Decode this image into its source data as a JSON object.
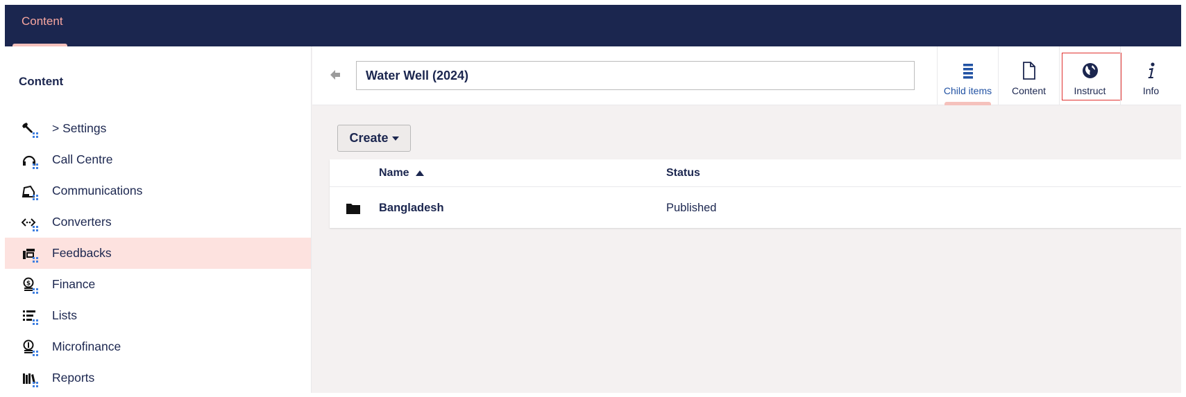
{
  "topbar": {
    "section_label": "Content"
  },
  "sidebar": {
    "title": "Content",
    "items": [
      {
        "label": "> Settings",
        "icon": "wrench-icon"
      },
      {
        "label": "Call Centre",
        "icon": "headset-icon"
      },
      {
        "label": "Communications",
        "icon": "inbox-icon"
      },
      {
        "label": "Converters",
        "icon": "code-arrows-icon"
      },
      {
        "label": "Feedbacks",
        "icon": "feedback-icon",
        "active": true
      },
      {
        "label": "Finance",
        "icon": "coins-icon"
      },
      {
        "label": "Lists",
        "icon": "list-icon"
      },
      {
        "label": "Microfinance",
        "icon": "microfinance-coins-icon"
      },
      {
        "label": "Reports",
        "icon": "books-icon"
      }
    ]
  },
  "editor": {
    "name_value": "Water Well (2024)",
    "apps": [
      {
        "label": "Child items",
        "icon": "list-lines-icon",
        "active": true
      },
      {
        "label": "Content",
        "icon": "document-icon"
      },
      {
        "label": "Instruct",
        "icon": "globe-icon",
        "outlined": true
      },
      {
        "label": "Info",
        "icon": "info-icon"
      }
    ],
    "create_label": "Create"
  },
  "list_view": {
    "columns": {
      "name": "Name",
      "status": "Status"
    },
    "rows": [
      {
        "name": "Bangladesh",
        "status": "Published",
        "icon": "folder-icon"
      }
    ]
  },
  "colors": {
    "topbar": "#1b264f",
    "accent": "#f5c1bc",
    "active_item_bg": "#fde2df",
    "highlight_outline": "#e0302f",
    "active_link": "#2152a3"
  }
}
